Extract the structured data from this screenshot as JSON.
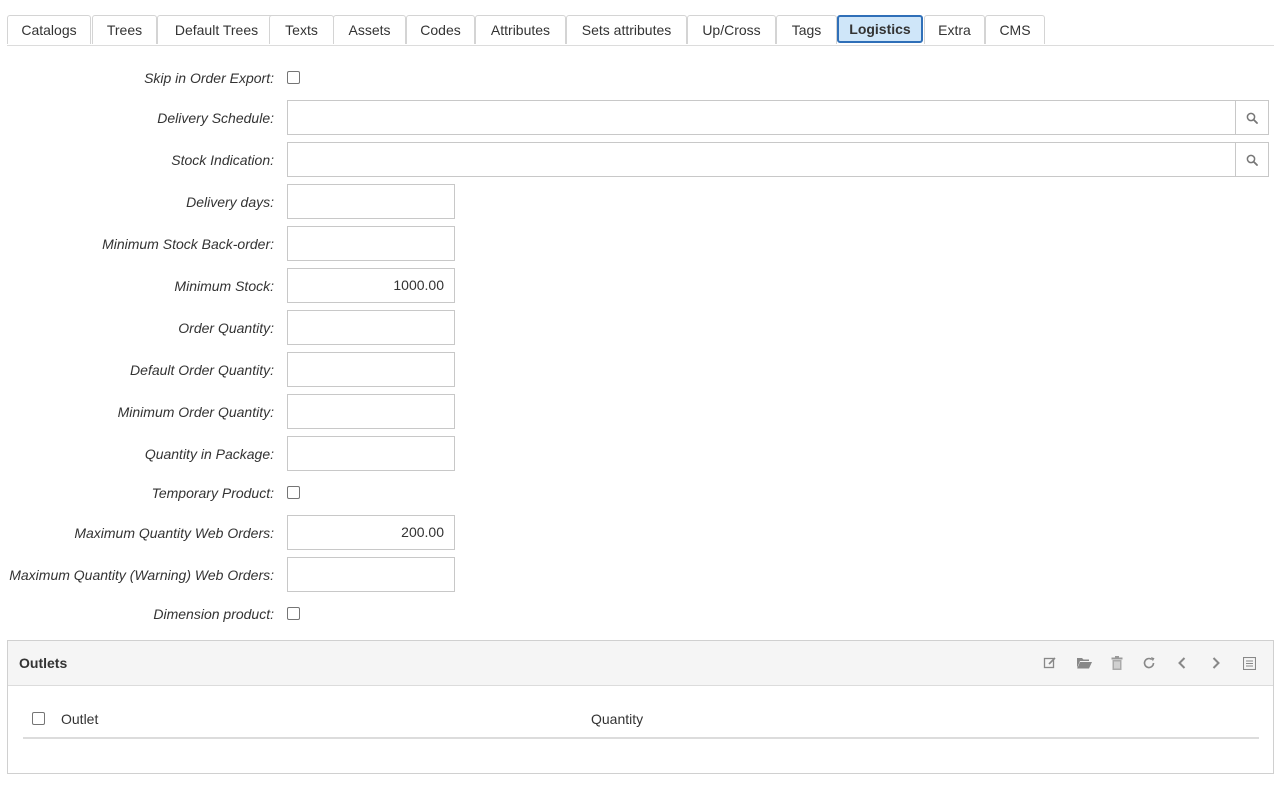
{
  "tabs": [
    {
      "label": "Catalogs",
      "active": false
    },
    {
      "label": "Trees",
      "active": false
    },
    {
      "label": "Default Trees",
      "active": false
    },
    {
      "label": "Texts",
      "active": false
    },
    {
      "label": "Assets",
      "active": false
    },
    {
      "label": "Codes",
      "active": false
    },
    {
      "label": "Attributes",
      "active": false
    },
    {
      "label": "Sets attributes",
      "active": false
    },
    {
      "label": "Up/Cross",
      "active": false
    },
    {
      "label": "Tags",
      "active": false
    },
    {
      "label": "Logistics",
      "active": true
    },
    {
      "label": "Extra",
      "active": false
    },
    {
      "label": "CMS",
      "active": false
    }
  ],
  "form": {
    "skip_order_export": {
      "label": "Skip in Order Export:",
      "checked": false
    },
    "delivery_schedule": {
      "label": "Delivery Schedule:",
      "value": ""
    },
    "stock_indication": {
      "label": "Stock Indication:",
      "value": ""
    },
    "delivery_days": {
      "label": "Delivery days:",
      "value": ""
    },
    "min_stock_backorder": {
      "label": "Minimum Stock Back-order:",
      "value": ""
    },
    "min_stock": {
      "label": "Minimum Stock:",
      "value": "1000.00"
    },
    "order_quantity": {
      "label": "Order Quantity:",
      "value": ""
    },
    "default_order_quantity": {
      "label": "Default Order Quantity:",
      "value": ""
    },
    "min_order_quantity": {
      "label": "Minimum Order Quantity:",
      "value": ""
    },
    "quantity_in_package": {
      "label": "Quantity in Package:",
      "value": ""
    },
    "temporary_product": {
      "label": "Temporary Product:",
      "checked": false
    },
    "max_qty_web_orders": {
      "label": "Maximum Quantity Web Orders:",
      "value": "200.00"
    },
    "max_qty_warning_web_orders": {
      "label": "Maximum Quantity (Warning) Web Orders:",
      "value": ""
    },
    "dimension_product": {
      "label": "Dimension product:",
      "checked": false
    }
  },
  "outlets": {
    "title": "Outlets",
    "columns": [
      "Outlet",
      "Quantity"
    ],
    "toolbar": [
      "edit-icon",
      "folder-open-icon",
      "trash-icon",
      "refresh-icon",
      "chevron-left-icon",
      "chevron-right-icon",
      "list-icon"
    ]
  },
  "colors": {
    "active_tab_bg": "#cfe6f9",
    "active_tab_border": "#2f6fb8",
    "icon": "#888888"
  }
}
